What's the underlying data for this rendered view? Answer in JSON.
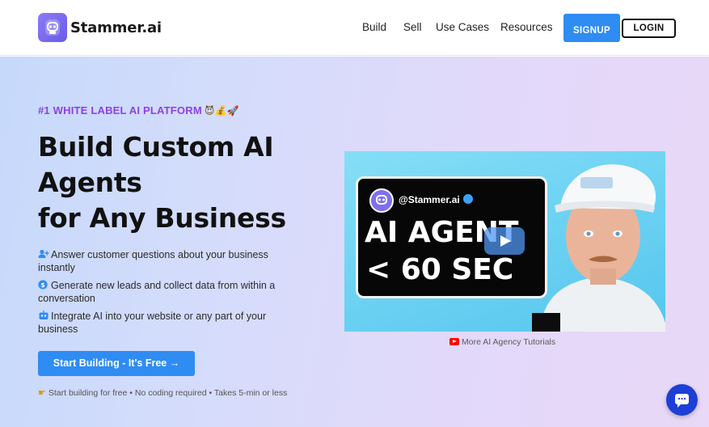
{
  "brand": {
    "name": "Stammer.ai",
    "logo_icon": "robot-face-icon",
    "accent": "#2f8cf3",
    "logo_color": "#7d6fef"
  },
  "nav": {
    "items": [
      "Build",
      "Sell",
      "Use Cases",
      "Resources"
    ],
    "signup_label": "SIGNUP",
    "login_label": "LOGIN"
  },
  "hero": {
    "eyebrow": "#1 WHITE LABEL AI PLATFORM",
    "eyebrow_emojis": "😈💰🚀",
    "eyebrow_color": "#8d3fe8",
    "headline": [
      "Build Custom AI",
      "Agents",
      "for Any Business"
    ],
    "features": [
      {
        "icon": "user-plus-icon",
        "text": "Answer customer questions about your business instantly"
      },
      {
        "icon": "dollar-chat-icon",
        "text": "Generate new leads and collect data from within a conversation"
      },
      {
        "icon": "robot-icon",
        "text": "Integrate AI into your website or any part of your business"
      }
    ],
    "cta_label": "Start Building - It's Free →",
    "fine_print": "Start building for free • No coding required • Takes 5-min or less",
    "fine_print_icon": "pointing-hand-icon"
  },
  "video": {
    "handle": "@Stammer.ai",
    "title_line1": "AI AGENT",
    "title_line2": "< 60 SEC",
    "caption": "More AI Agency Tutorials",
    "caption_icon": "youtube-icon"
  },
  "chat_widget": {
    "icon": "chat-bubble-icon",
    "color": "#1d3fd6"
  }
}
